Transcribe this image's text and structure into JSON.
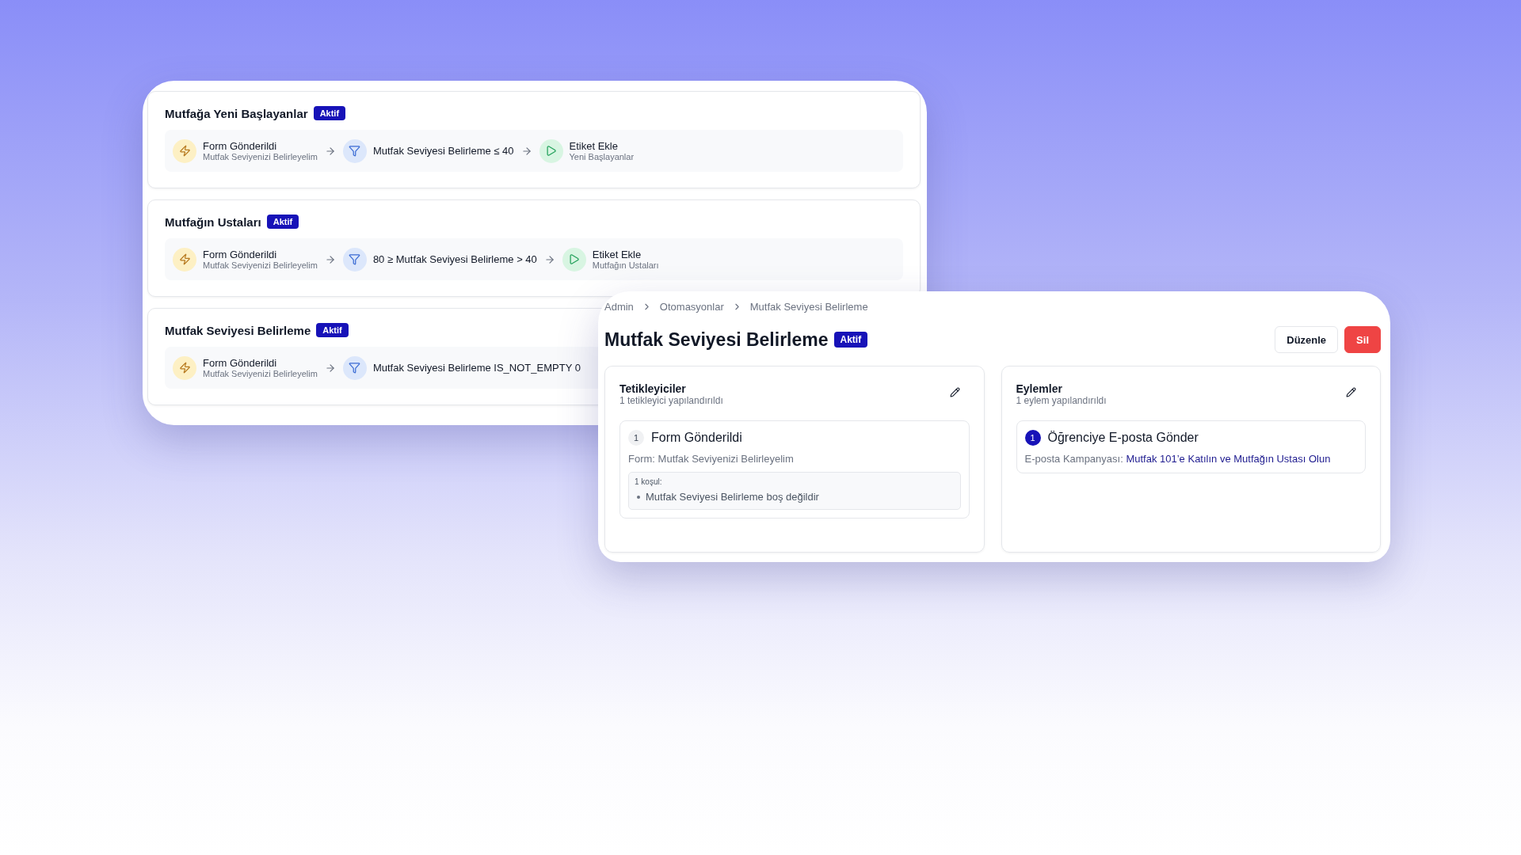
{
  "automations": [
    {
      "title": "Mutfağa Yeni Başlayanlar",
      "status": "Aktif",
      "steps": [
        {
          "kind": "trigger",
          "label": "Form Gönderildi",
          "sub": "Mutfak Seviyenizi Belirleyelim"
        },
        {
          "kind": "filter",
          "label": "Mutfak Seviyesi Belirleme ≤ 40"
        },
        {
          "kind": "action",
          "label": "Etiket Ekle",
          "sub": "Yeni Başlayanlar"
        }
      ]
    },
    {
      "title": "Mutfağın Ustaları",
      "status": "Aktif",
      "steps": [
        {
          "kind": "trigger",
          "label": "Form Gönderildi",
          "sub": "Mutfak Seviyenizi Belirleyelim"
        },
        {
          "kind": "filter",
          "label": "80 ≥ Mutfak Seviyesi Belirleme > 40"
        },
        {
          "kind": "action",
          "label": "Etiket Ekle",
          "sub": "Mutfağın Ustaları"
        }
      ]
    },
    {
      "title": "Mutfak Seviyesi Belirleme",
      "status": "Aktif",
      "steps": [
        {
          "kind": "trigger",
          "label": "Form Gönderildi",
          "sub": "Mutfak Seviyenizi Belirleyelim"
        },
        {
          "kind": "filter",
          "label": "Mutfak Seviyesi Belirleme IS_NOT_EMPTY 0"
        }
      ]
    }
  ],
  "detail": {
    "breadcrumb": [
      "Admin",
      "Otomasyonlar",
      "Mutfak Seviyesi Belirleme"
    ],
    "title": "Mutfak Seviyesi Belirleme",
    "status": "Aktif",
    "buttons": [
      {
        "label": "Düzenle",
        "kind": "secondary"
      },
      {
        "label": "Sil",
        "kind": "danger"
      }
    ],
    "panels": [
      {
        "kind": "triggers",
        "title": "Tetikleyiciler",
        "subtitle": "1 tetikleyici yapılandırıldı",
        "items": [
          {
            "number": "1",
            "title": "Form Gönderildi",
            "detail_label": "Form:",
            "detail_value": "Mutfak Seviyenizi Belirleyelim",
            "conditions_label": "1 koşul:",
            "conditions": [
              "Mutfak Seviyesi Belirleme boş değildir"
            ]
          }
        ]
      },
      {
        "kind": "actions",
        "title": "Eylemler",
        "subtitle": "1 eylem yapılandırıldı",
        "items": [
          {
            "number": "1",
            "title": "Öğrenciye E-posta Gönder",
            "detail_label": "E-posta Kampanyası:",
            "detail_value": "Mutfak 101’e Katılın ve Mutfağın Ustası Olun"
          }
        ]
      }
    ]
  }
}
